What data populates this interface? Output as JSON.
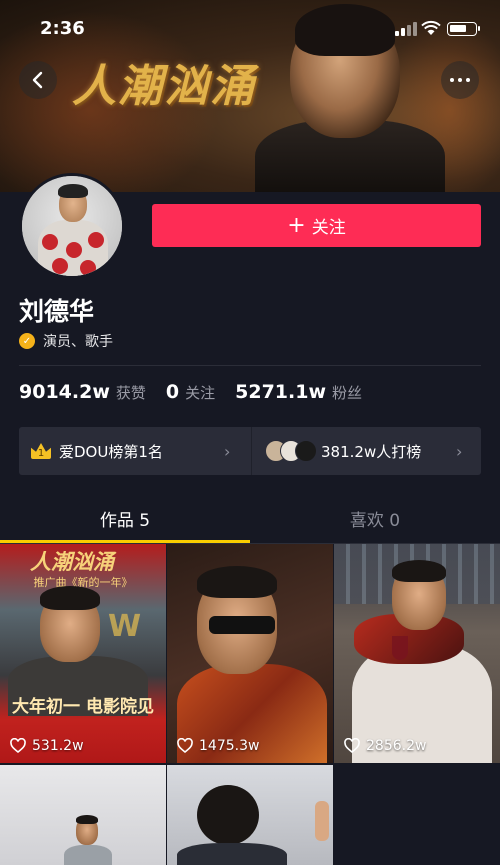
{
  "status_bar": {
    "time": "2:36"
  },
  "banner": {
    "title": "人潮汹涌"
  },
  "profile": {
    "name": "刘德华",
    "verified_text": "演员、歌手",
    "follow_button": "关注",
    "stats": [
      {
        "value": "9014.2w",
        "label": "获赞"
      },
      {
        "value": "0",
        "label": "关注"
      },
      {
        "value": "5271.1w",
        "label": "粉丝"
      }
    ]
  },
  "ranking": {
    "left_text": "爱DOU榜第1名",
    "right_text": "381.2w人打榜"
  },
  "tabs": [
    {
      "label": "作品 5"
    },
    {
      "label": "喜欢 0"
    }
  ],
  "videos": [
    {
      "likes": "531.2w",
      "poster_title": "人潮汹涌",
      "poster_sub": "推广曲《新的一年》",
      "poster_bottom": "大年初一 电影院见",
      "mark": "W"
    },
    {
      "likes": "1475.3w"
    },
    {
      "likes": "2856.2w"
    },
    {},
    {}
  ],
  "colors": {
    "accent": "#fe2c55",
    "tab_indicator": "#facd00",
    "background": "#161823",
    "verified": "#f5b21a"
  },
  "icons": [
    "back-arrow-icon",
    "more-dots-icon",
    "plus-icon",
    "verified-badge-icon",
    "crown-icon",
    "chevron-right-icon",
    "heart-icon"
  ]
}
